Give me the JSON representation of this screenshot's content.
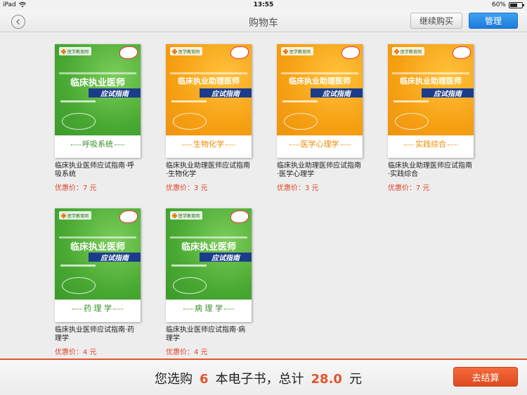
{
  "status_bar": {
    "device": "iPad",
    "time": "13:55",
    "battery": "60%",
    "battery_level": 0.6
  },
  "nav": {
    "title": "购物车",
    "continue_label": "继续购买",
    "manage_label": "管理"
  },
  "cover_text": {
    "logo": "医学教育网",
    "title_book": "临床执业医师",
    "title_assistant": "临床执业助理医师",
    "banner": "应试指南"
  },
  "books": [
    {
      "cover_color": "#49a933",
      "cover_caption": "呼吸系统",
      "name_line1": "临床执业医师应试指南·呼",
      "name_line2": "吸系统",
      "price": "优惠价：7 元"
    },
    {
      "cover_color": "#f6a013",
      "cover_caption": "生物化学",
      "name_line1": "临床执业助理医师应试指南",
      "name_line2": "·生物化学",
      "price": "优惠价：3 元"
    },
    {
      "cover_color": "#f6a013",
      "cover_caption": "医学心理学",
      "name_line1": "临床执业助理医师应试指南",
      "name_line2": "·医学心理学",
      "price": "优惠价：3 元"
    },
    {
      "cover_color": "#f6a013",
      "cover_caption": "实践综合",
      "name_line1": "临床执业助理医师应试指南",
      "name_line2": "·实践综合",
      "price": "优惠价：7 元"
    },
    {
      "cover_color": "#49a933",
      "cover_caption": "药 理 学",
      "name_line1": "临床执业医师应试指南·药",
      "name_line2": "理学",
      "price": "优惠价：4 元"
    },
    {
      "cover_color": "#49a933",
      "cover_caption": "病 理 学",
      "name_line1": "临床执业医师应试指南·病",
      "name_line2": "理学",
      "price": "优惠价：4 元"
    }
  ],
  "summary": {
    "prefix": "您选购",
    "count": "6",
    "middle": "本电子书，总计",
    "total": "28.0",
    "suffix": "元"
  },
  "checkout_label": "去结算",
  "colors": {
    "accent_blue": "#1e7ad8",
    "accent_orange": "#e2542c",
    "price_red": "#e0442a"
  }
}
